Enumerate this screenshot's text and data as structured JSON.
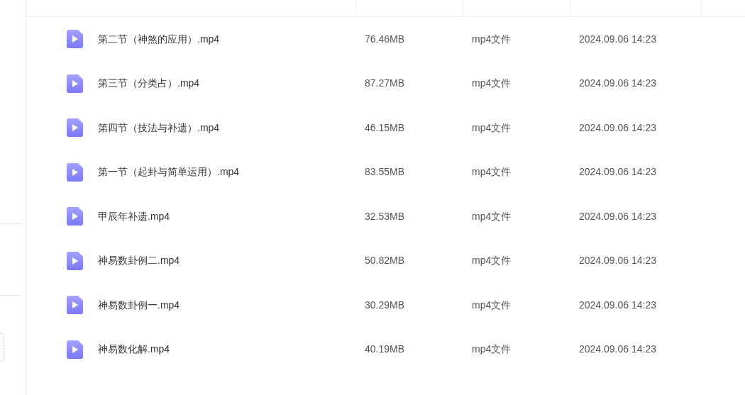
{
  "files": [
    {
      "name": "第二节（神煞的应用）.mp4",
      "size": "76.46MB",
      "type": "mp4文件",
      "modified": "2024.09.06 14:23"
    },
    {
      "name": "第三节（分类占）.mp4",
      "size": "87.27MB",
      "type": "mp4文件",
      "modified": "2024.09.06 14:23"
    },
    {
      "name": "第四节（技法与补遗）.mp4",
      "size": "46.15MB",
      "type": "mp4文件",
      "modified": "2024.09.06 14:23"
    },
    {
      "name": "第一节（起卦与简单运用）.mp4",
      "size": "83.55MB",
      "type": "mp4文件",
      "modified": "2024.09.06 14:23"
    },
    {
      "name": "甲辰年补遗.mp4",
      "size": "32.53MB",
      "type": "mp4文件",
      "modified": "2024.09.06 14:23"
    },
    {
      "name": "神易数卦例二.mp4",
      "size": "50.82MB",
      "type": "mp4文件",
      "modified": "2024.09.06 14:23"
    },
    {
      "name": "神易数卦例一.mp4",
      "size": "30.29MB",
      "type": "mp4文件",
      "modified": "2024.09.06 14:23"
    },
    {
      "name": "神易数化解.mp4",
      "size": "40.19MB",
      "type": "mp4文件",
      "modified": "2024.09.06 14:23"
    }
  ]
}
